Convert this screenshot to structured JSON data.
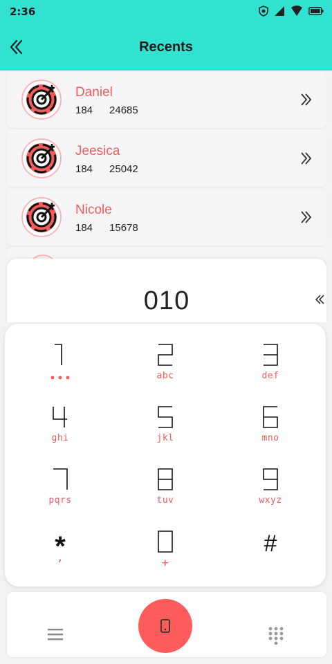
{
  "status": {
    "time": "2:36"
  },
  "header": {
    "title": "Recents"
  },
  "contacts": [
    {
      "name": "Daniel",
      "code": "184",
      "number": "24685"
    },
    {
      "name": "Jeesica",
      "code": "184",
      "number": "25042"
    },
    {
      "name": "Nicole",
      "code": "184",
      "number": "15678"
    }
  ],
  "dialer": {
    "number": "010",
    "keys": [
      {
        "digit": "1",
        "letters": ""
      },
      {
        "digit": "2",
        "letters": "abc"
      },
      {
        "digit": "3",
        "letters": "def"
      },
      {
        "digit": "4",
        "letters": "ghi"
      },
      {
        "digit": "5",
        "letters": "jkl"
      },
      {
        "digit": "6",
        "letters": "mno"
      },
      {
        "digit": "7",
        "letters": "pqrs"
      },
      {
        "digit": "8",
        "letters": "tuv"
      },
      {
        "digit": "9",
        "letters": "wxyz"
      },
      {
        "digit": "*",
        "letters": ","
      },
      {
        "digit": "0",
        "letters": "+"
      },
      {
        "digit": "#",
        "letters": ""
      }
    ]
  },
  "colors": {
    "accent": "#31e2d1",
    "red": "#fe5b5b",
    "name": "#f25b5b"
  },
  "icons": [
    "back-icon",
    "chevron-right-icon",
    "backspace-icon",
    "menu-icon",
    "phone-icon",
    "keypad-icon"
  ]
}
